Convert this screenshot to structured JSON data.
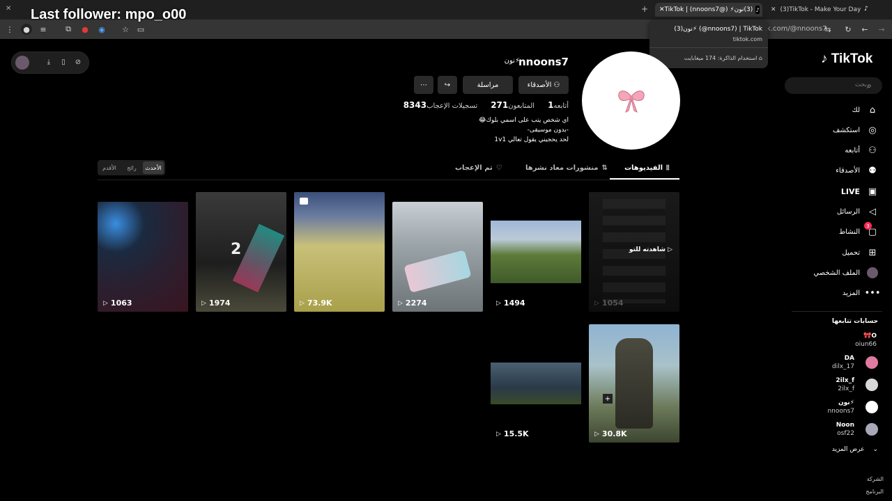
{
  "overlay": {
    "title": "Last follower: mpo_o00"
  },
  "browser": {
    "tabs": [
      {
        "label": "(3)TikTok - Make Your Day",
        "icon": "tiktok-icon"
      },
      {
        "label": "(3)نون⚡ (@nnoons7) | TikTok",
        "icon": "tiktok-icon",
        "active": true
      }
    ],
    "address": "k.com/@nnoons7",
    "hovercard": {
      "title": "(3)نون⚡ (@nnoons7) | TikTok",
      "site": "tiktok.com",
      "memory": "استخدام الذاكرة: 174 ميغابايت"
    }
  },
  "sidebar": {
    "logo": "TikTok",
    "search_placeholder": "بحث",
    "nav": [
      {
        "label": "لك",
        "icon": "home-icon"
      },
      {
        "label": "استكشف",
        "icon": "compass-icon"
      },
      {
        "label": "أتابعه",
        "icon": "following-icon"
      },
      {
        "label": "الأصدقاء",
        "icon": "friends-icon"
      },
      {
        "label": "LIVE",
        "icon": "live-icon"
      },
      {
        "label": "الرسائل",
        "icon": "send-icon"
      },
      {
        "label": "النشاط",
        "icon": "activity-icon",
        "badge": "3"
      },
      {
        "label": "تحميل",
        "icon": "upload-icon"
      },
      {
        "label": "الملف الشخصي",
        "icon": "profile-avatar-icon"
      },
      {
        "label": "المزيد",
        "icon": "more-icon"
      }
    ],
    "following_title": "حسابات تتابعها",
    "following": [
      {
        "name": "🎀O",
        "handle": "oiun66"
      },
      {
        "name": "DA",
        "handle": "dilx_17"
      },
      {
        "name": "2ilx_f",
        "handle": "2ilx_f"
      },
      {
        "name": "نون⚡",
        "handle": "nnoons7"
      },
      {
        "name": "Noon",
        "handle": "osf22"
      }
    ],
    "see_more": "عرض المزيد",
    "footer": [
      "الشركة",
      "البرنامج"
    ]
  },
  "profile": {
    "username": "nnoons7",
    "nickname": "نون⚡",
    "buttons": {
      "friends": "الأصدقاء",
      "message": "مراسلة"
    },
    "stats": [
      {
        "value": "1",
        "label": "أتابعه"
      },
      {
        "value": "271",
        "label": "المتابعون"
      },
      {
        "value": "8343",
        "label": "تسجيلات الإعجاب"
      }
    ],
    "bio": [
      "اي شخص يتب على اسمي بلوك😂",
      "-بدون موسيقى-",
      "لحد يحجيني يقول تعالي 1v1"
    ]
  },
  "tabs": {
    "videos": "الفيديوهات",
    "reposts": "منشورات معاد نشرها",
    "liked": "تم الإعجاب"
  },
  "sort": {
    "latest": "الأحدث",
    "popular": "رائج",
    "oldest": "الأقدم"
  },
  "videos": [
    {
      "count": "1054",
      "label": "شاهدته للتو"
    },
    {
      "count": "1494"
    },
    {
      "count": "2274"
    },
    {
      "count": "73.9K"
    },
    {
      "count": "1974"
    },
    {
      "count": "1063"
    },
    {
      "count": "30.8K"
    },
    {
      "count": "15.5K"
    }
  ]
}
